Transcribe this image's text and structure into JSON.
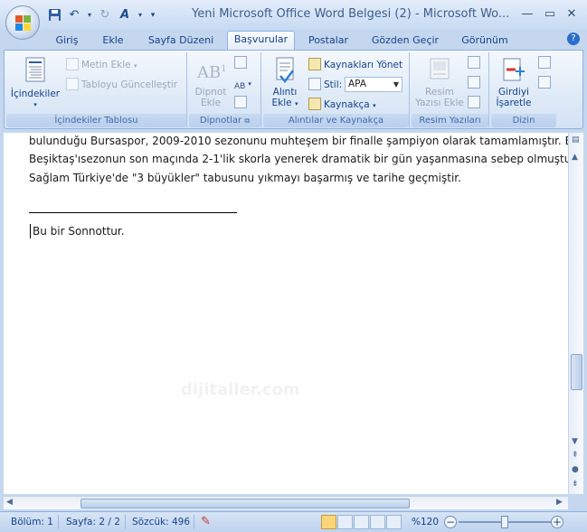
{
  "titlebar": {
    "title": "Yeni Microsoft Office Word Belgesi (2) - Microsoft Wo...",
    "minimize": "—",
    "restore": "▭",
    "close": "✕"
  },
  "qat": {
    "save_icon": "save-icon",
    "undo_icon": "undo-icon",
    "redo_icon": "redo-icon",
    "format_icon": "format-icon",
    "customize_icon": "qat-customize-icon"
  },
  "tabs": [
    "Giriş",
    "Ekle",
    "Sayfa Düzeni",
    "Başvurular",
    "Postalar",
    "Gözden Geçir",
    "Görünüm"
  ],
  "active_tab": "Başvurular",
  "ribbon": {
    "toc_group": {
      "label": "İçindekiler Tablosu",
      "toc_button": "İçindekiler",
      "add_text": "Metin Ekle",
      "update_table": "Tabloyu Güncelleştir"
    },
    "footnotes_group": {
      "label": "Dipnotlar",
      "insert_footnote_line1": "Dipnot",
      "insert_footnote_line2": "Ekle",
      "ab_icon_text": "AB",
      "ab_superscript": "1"
    },
    "citations_group": {
      "label": "Alıntılar ve Kaynakça",
      "insert_citation_line1": "Alıntı",
      "insert_citation_line2": "Ekle",
      "manage_sources": "Kaynakları Yönet",
      "style_label": "Stil:",
      "style_value": "APA",
      "bibliography": "Kaynakça"
    },
    "captions_group": {
      "label": "Resim Yazıları",
      "insert_caption_line1": "Resim",
      "insert_caption_line2": "Yazısı Ekle"
    },
    "index_group": {
      "label": "Dizin",
      "mark_entry_line1": "Girdiyi",
      "mark_entry_line2": "İşaretle"
    }
  },
  "document": {
    "lines": [
      "bulunduğu Bursaspor, 2009-2010 sezonunu muhteşem bir finalle şampiyon olarak tamamlamıştır. Bursa",
      "Beşiktaş'ısezonun son maçında 2-1'lik skorla yenerek dramatik bir gün yaşanmasına sebep olmuştur. B",
      "Sağlam Türkiye'de \"3 büyükler\" tabusunu yıkmayı başarmış ve tarihe geçmiştir."
    ],
    "footnote": "Bu bir Sonnottur.",
    "watermark": "dijitaller.com"
  },
  "statusbar": {
    "section": "Bölüm: 1",
    "page": "Sayfa: 2 / 2",
    "words": "Sözcük: 496",
    "zoom": "%120",
    "zoom_level_percent": 120
  },
  "colors": {
    "ribbon_bg": "#dfeaf7",
    "accent_text": "#15428b",
    "active_view": "#fbd57a"
  }
}
